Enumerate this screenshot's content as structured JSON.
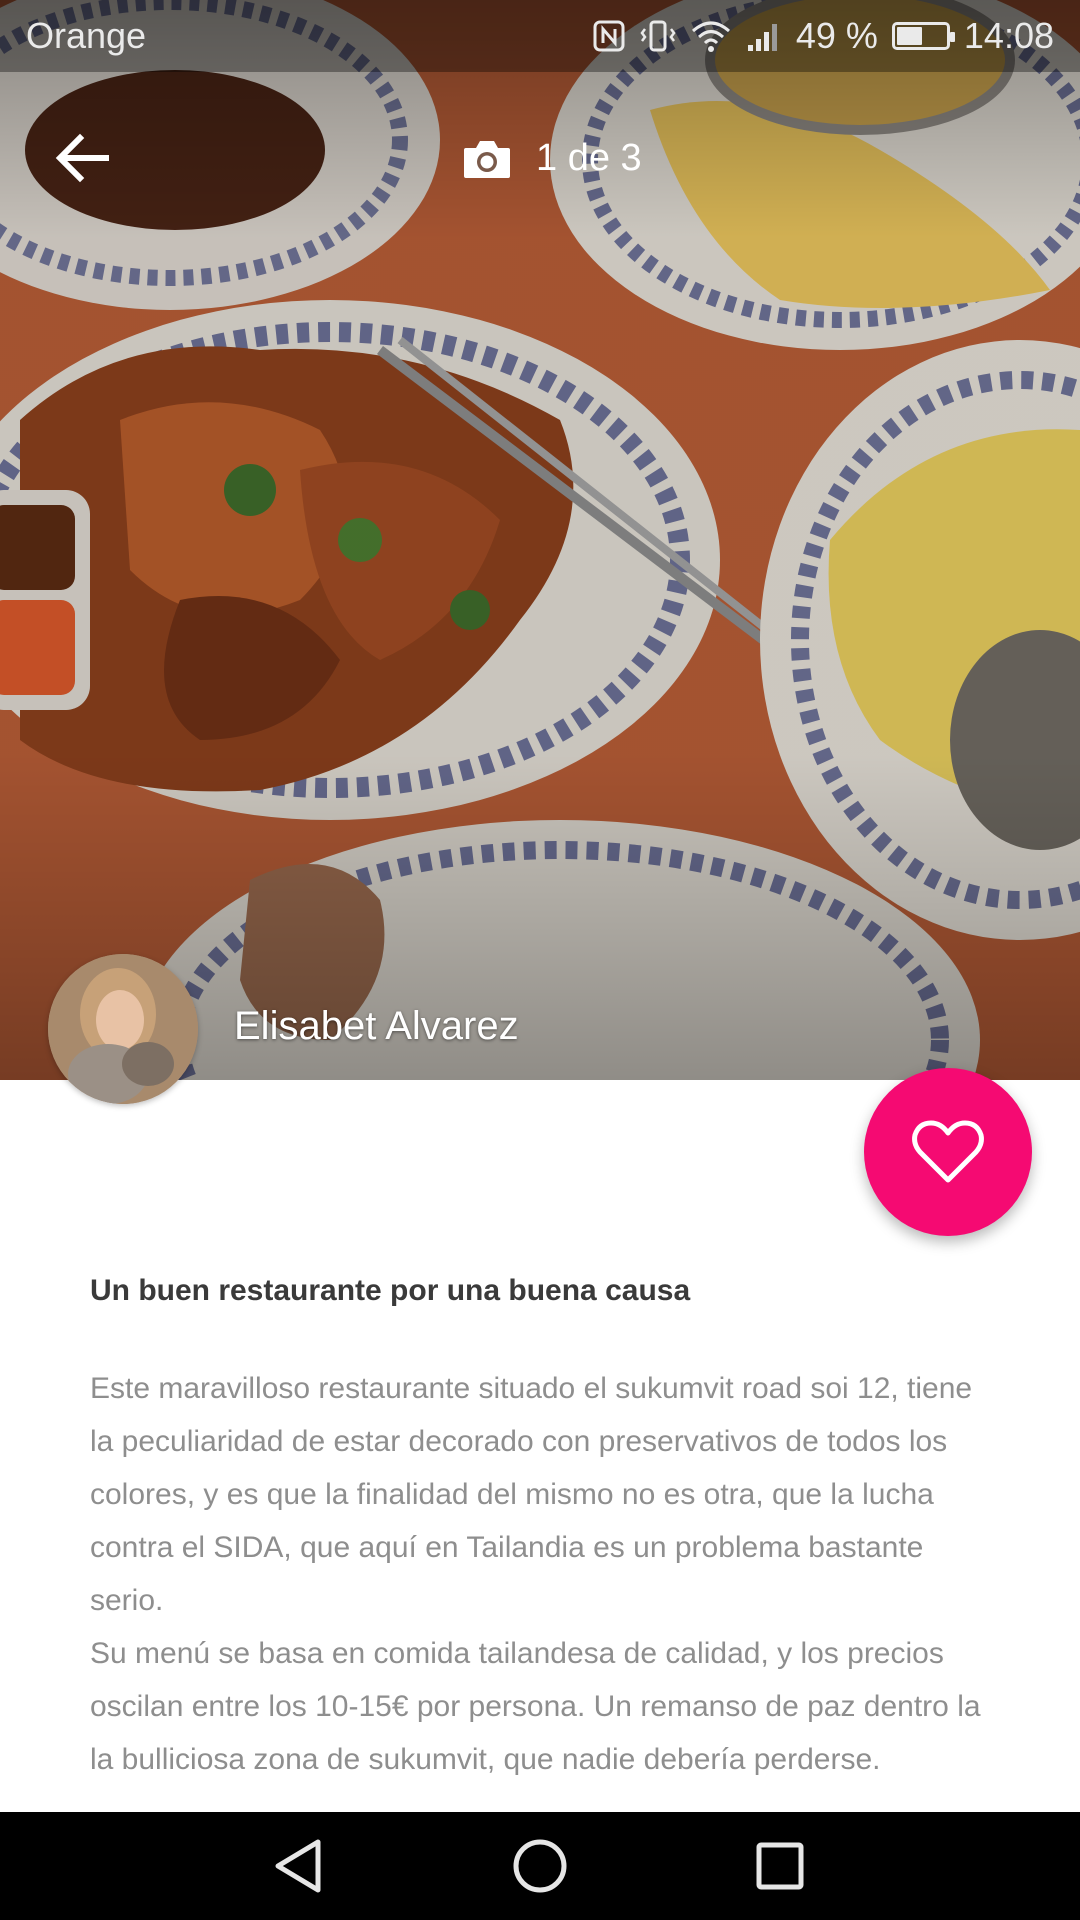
{
  "status_bar": {
    "carrier": "Orange",
    "battery_percent": "49 %",
    "battery_level": 0.49,
    "time": "14:08",
    "icons": [
      "nfc-icon",
      "vibrate-icon",
      "wifi-icon",
      "signal-icon",
      "battery-icon"
    ]
  },
  "toolbar": {
    "back_icon": "arrow-left-icon",
    "camera_icon": "camera-icon",
    "photo_counter": "1 de 3"
  },
  "author": {
    "name": "Elisabet Alvarez"
  },
  "fab": {
    "icon": "heart-outline-icon",
    "color": "#f50a72"
  },
  "article": {
    "title": "Un buen restaurante por una buena causa",
    "paragraphs": [
      "Este maravilloso restaurante situado el sukumvit road soi 12, tiene la peculiaridad de estar decorado con preservativos de todos los colores, y es que la finalidad del mismo no es otra, que la lucha contra el SIDA, que aquí en Tailandia es un problema bastante serio.",
      "Su menú se basa en comida tailandesa de calidad, y los precios oscilan entre los 10-15€ por persona. Un remanso de paz dentro la la bulliciosa zona de sukumvit, que nadie debería perderse."
    ]
  },
  "nav_bar": {
    "icons": [
      "nav-back-icon",
      "nav-home-icon",
      "nav-recents-icon"
    ]
  }
}
